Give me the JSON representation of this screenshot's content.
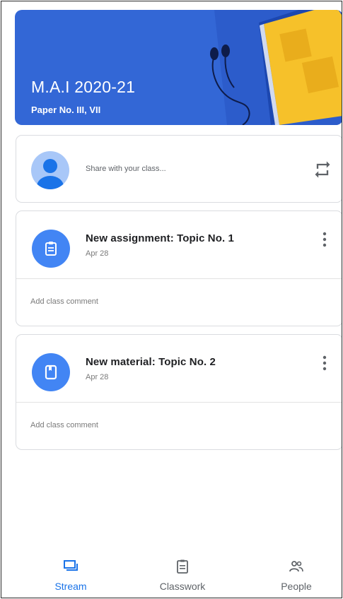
{
  "class_header": {
    "title": "M.A.I 2020-21",
    "subtitle": "Paper No. III, VII",
    "banner_color": "#3367d6"
  },
  "share": {
    "placeholder": "Share with your class...",
    "avatar_icon": "person-avatar-icon",
    "repost_icon": "repost-icon"
  },
  "posts": [
    {
      "title": "New assignment: Topic No. 1",
      "date": "Apr 28",
      "icon": "assignment-icon",
      "comment": "Add class comment"
    },
    {
      "title": "New material: Topic No. 2",
      "date": "Apr 28",
      "icon": "material-icon",
      "comment": "Add class comment"
    }
  ],
  "nav": {
    "items": [
      {
        "label": "Stream",
        "icon": "stream-icon",
        "active": true
      },
      {
        "label": "Classwork",
        "icon": "classwork-icon",
        "active": false
      },
      {
        "label": "People",
        "icon": "people-icon",
        "active": false
      }
    ]
  },
  "colors": {
    "accent": "#1a73e8",
    "icon_circle": "#4285f4",
    "book_yellow": "#f6c12a"
  }
}
